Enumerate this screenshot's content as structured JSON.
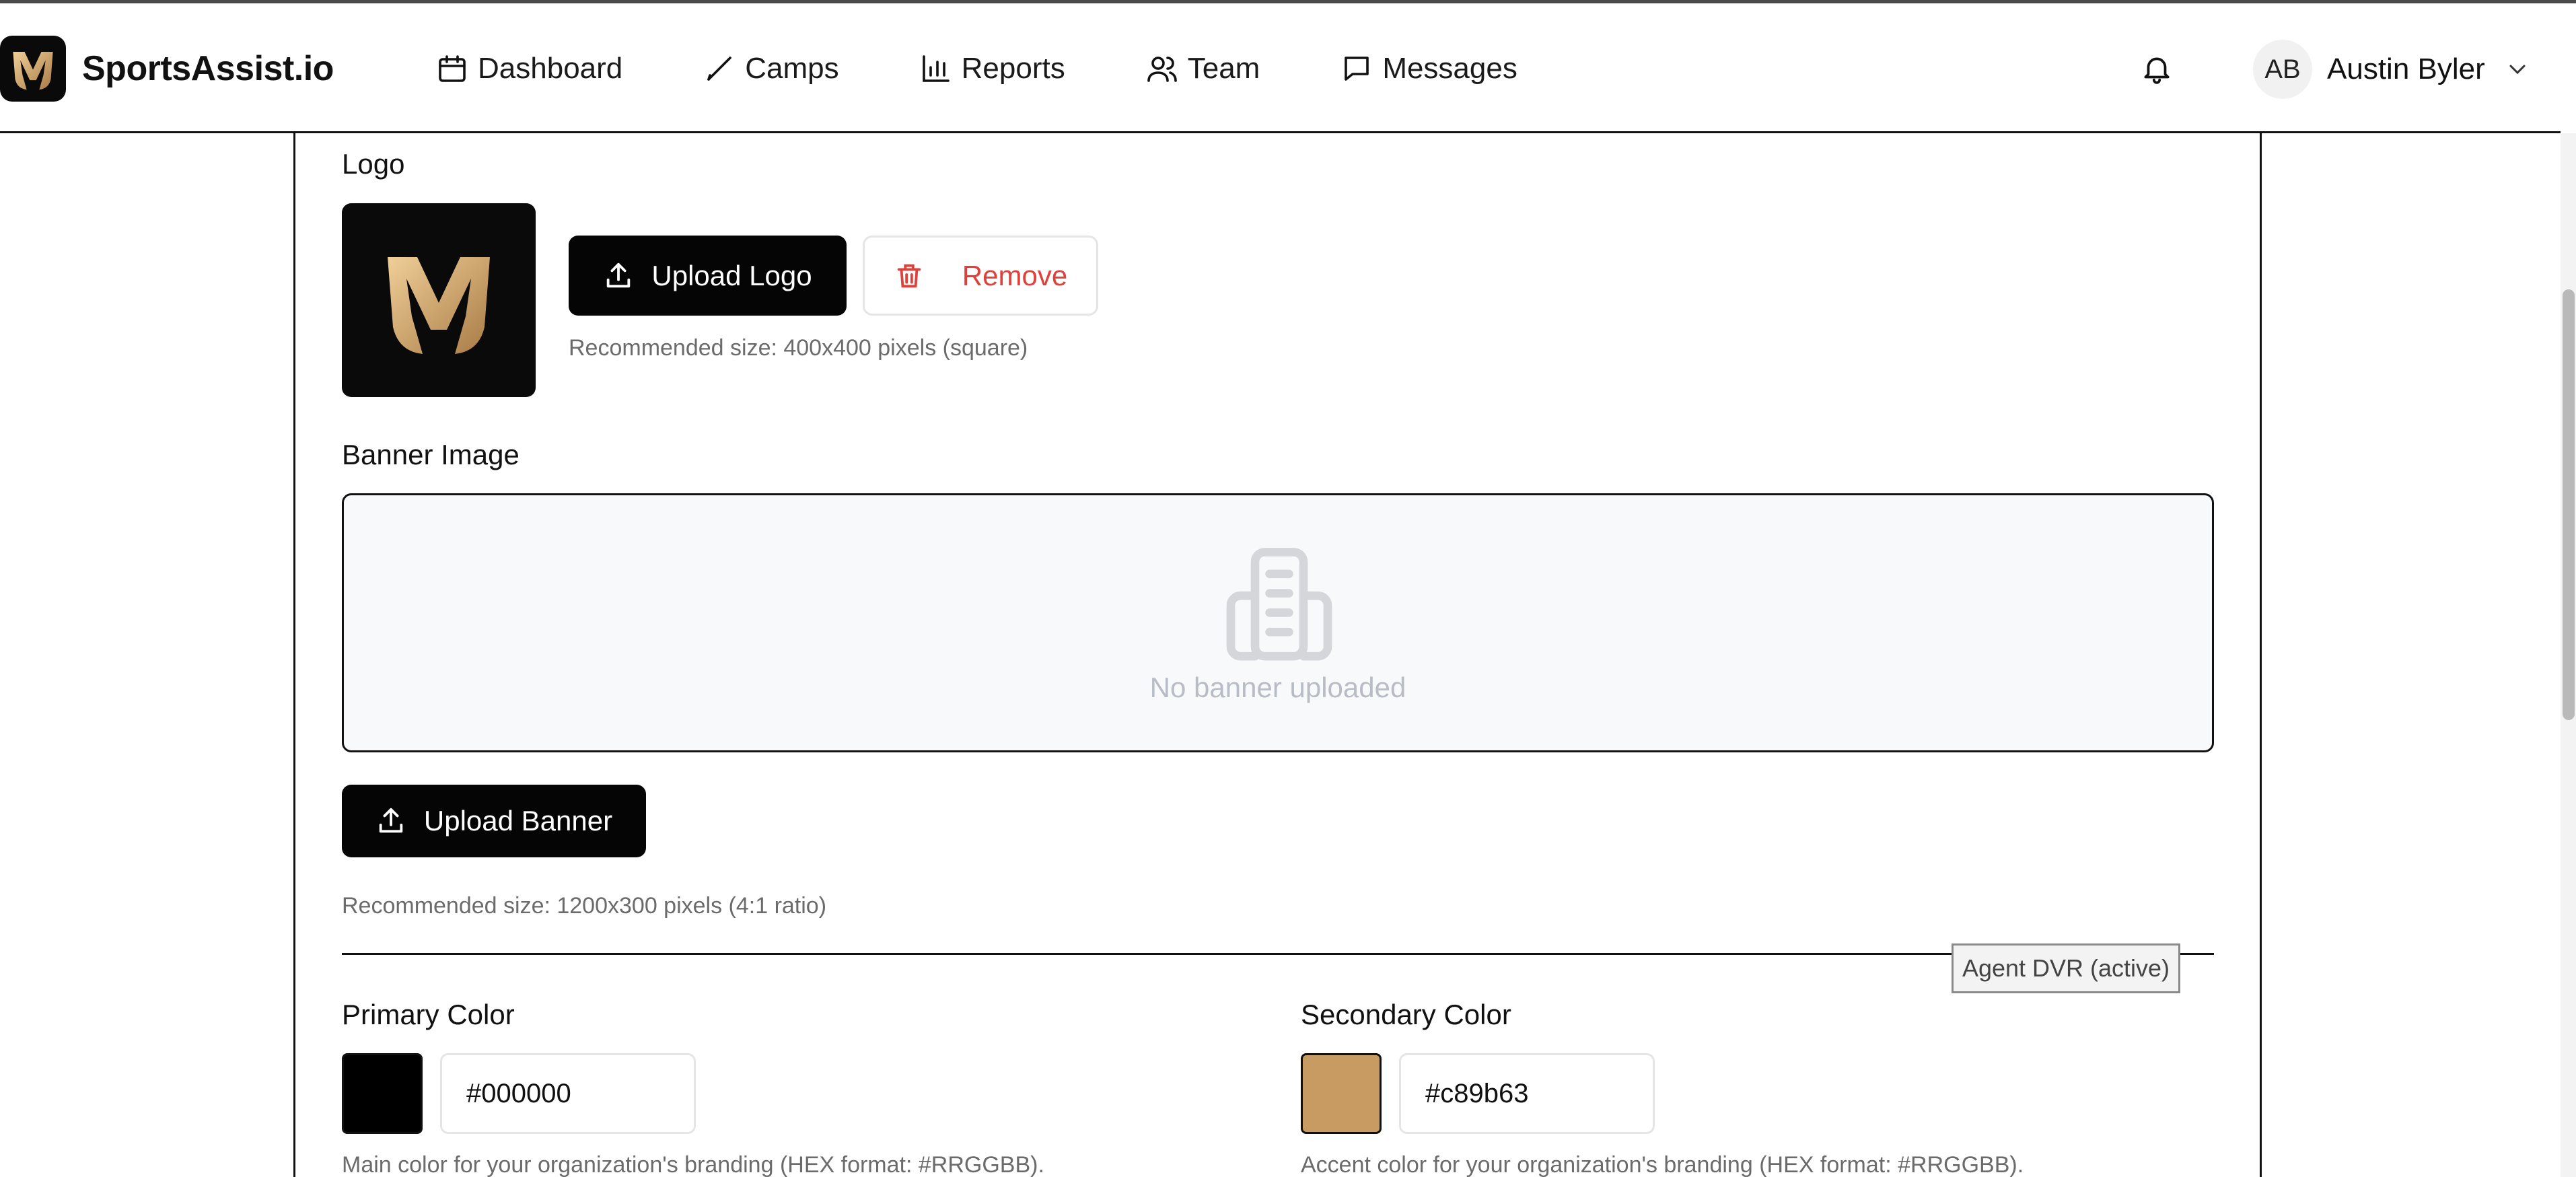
{
  "app": {
    "brand_name": "SportsAssist.io"
  },
  "nav": {
    "items": [
      {
        "label": "Dashboard",
        "icon": "calendar-icon"
      },
      {
        "label": "Camps",
        "icon": "pen-icon"
      },
      {
        "label": "Reports",
        "icon": "bar-chart-icon"
      },
      {
        "label": "Team",
        "icon": "users-icon"
      },
      {
        "label": "Messages",
        "icon": "message-icon"
      }
    ]
  },
  "user": {
    "initials": "AB",
    "name": "Austin Byler"
  },
  "logo_section": {
    "label": "Logo",
    "upload_button": "Upload Logo",
    "remove_button": "Remove",
    "hint": "Recommended size: 400x400 pixels (square)"
  },
  "banner_section": {
    "label": "Banner Image",
    "empty_text": "No banner uploaded",
    "upload_button": "Upload Banner",
    "hint": "Recommended size: 1200x300 pixels (4:1 ratio)"
  },
  "tooltip": "Agent DVR (active)",
  "colors": {
    "primary": {
      "label": "Primary Color",
      "value": "#000000",
      "hint": "Main color for your organization's branding (HEX format: #RRGGBB)."
    },
    "secondary": {
      "label": "Secondary Color",
      "value": "#c89b63",
      "hint": "Accent color for your organization's branding (HEX format: #RRGGBB)."
    },
    "danger": "#e0403a"
  }
}
